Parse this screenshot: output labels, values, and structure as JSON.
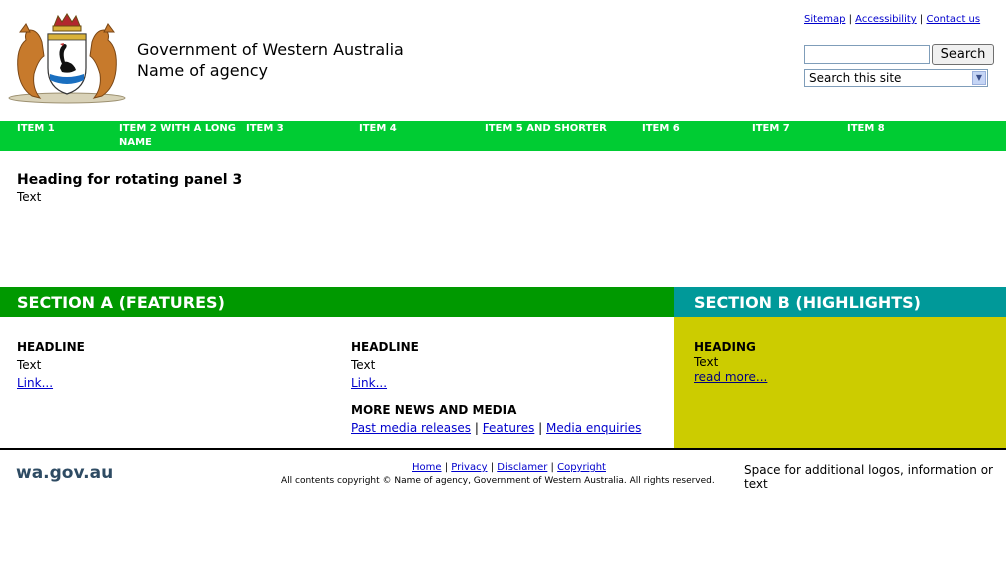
{
  "header": {
    "gov_title": "Government of Western Australia",
    "agency_name": "Name of agency",
    "util_links": [
      "Sitemap",
      "Accessibility",
      "Contact us"
    ],
    "search_button": "Search",
    "search_input_value": "",
    "search_scope": "Search this site"
  },
  "nav": {
    "items": [
      "ITEM 1",
      "ITEM 2 WITH A LONG NAME",
      "ITEM 3",
      "ITEM 4",
      "ITEM 5 AND SHORTER",
      "ITEM 6",
      "ITEM 7",
      "ITEM 8"
    ]
  },
  "panel": {
    "heading": "Heading for rotating panel 3",
    "text": "Text"
  },
  "section_a": {
    "title": "SECTION A (FEATURES)",
    "col1": {
      "headline": "HEADLINE",
      "text": "Text",
      "link": "Link..."
    },
    "col2": {
      "headline": "HEADLINE",
      "text": "Text",
      "link": "Link..."
    },
    "more_news": {
      "heading": "MORE NEWS AND MEDIA",
      "links": [
        "Past media releases",
        "Features",
        "Media enquiries"
      ]
    }
  },
  "section_b": {
    "title": "SECTION B (HIGHLIGHTS)",
    "heading": "HEADING",
    "text": "Text",
    "link": "read more..."
  },
  "footer": {
    "logo": "wa.gov.au",
    "links": [
      "Home",
      "Privacy",
      "Disclamer",
      "Copyright"
    ],
    "copyright": "All contents copyright © Name of agency, Government of Western Australia. All rights reserved.",
    "extra": "Space for additional logos, information or text"
  },
  "colors": {
    "nav": "#00cc33",
    "section_a": "#009900",
    "section_b": "#009999",
    "section_b_body": "#cccc00"
  }
}
